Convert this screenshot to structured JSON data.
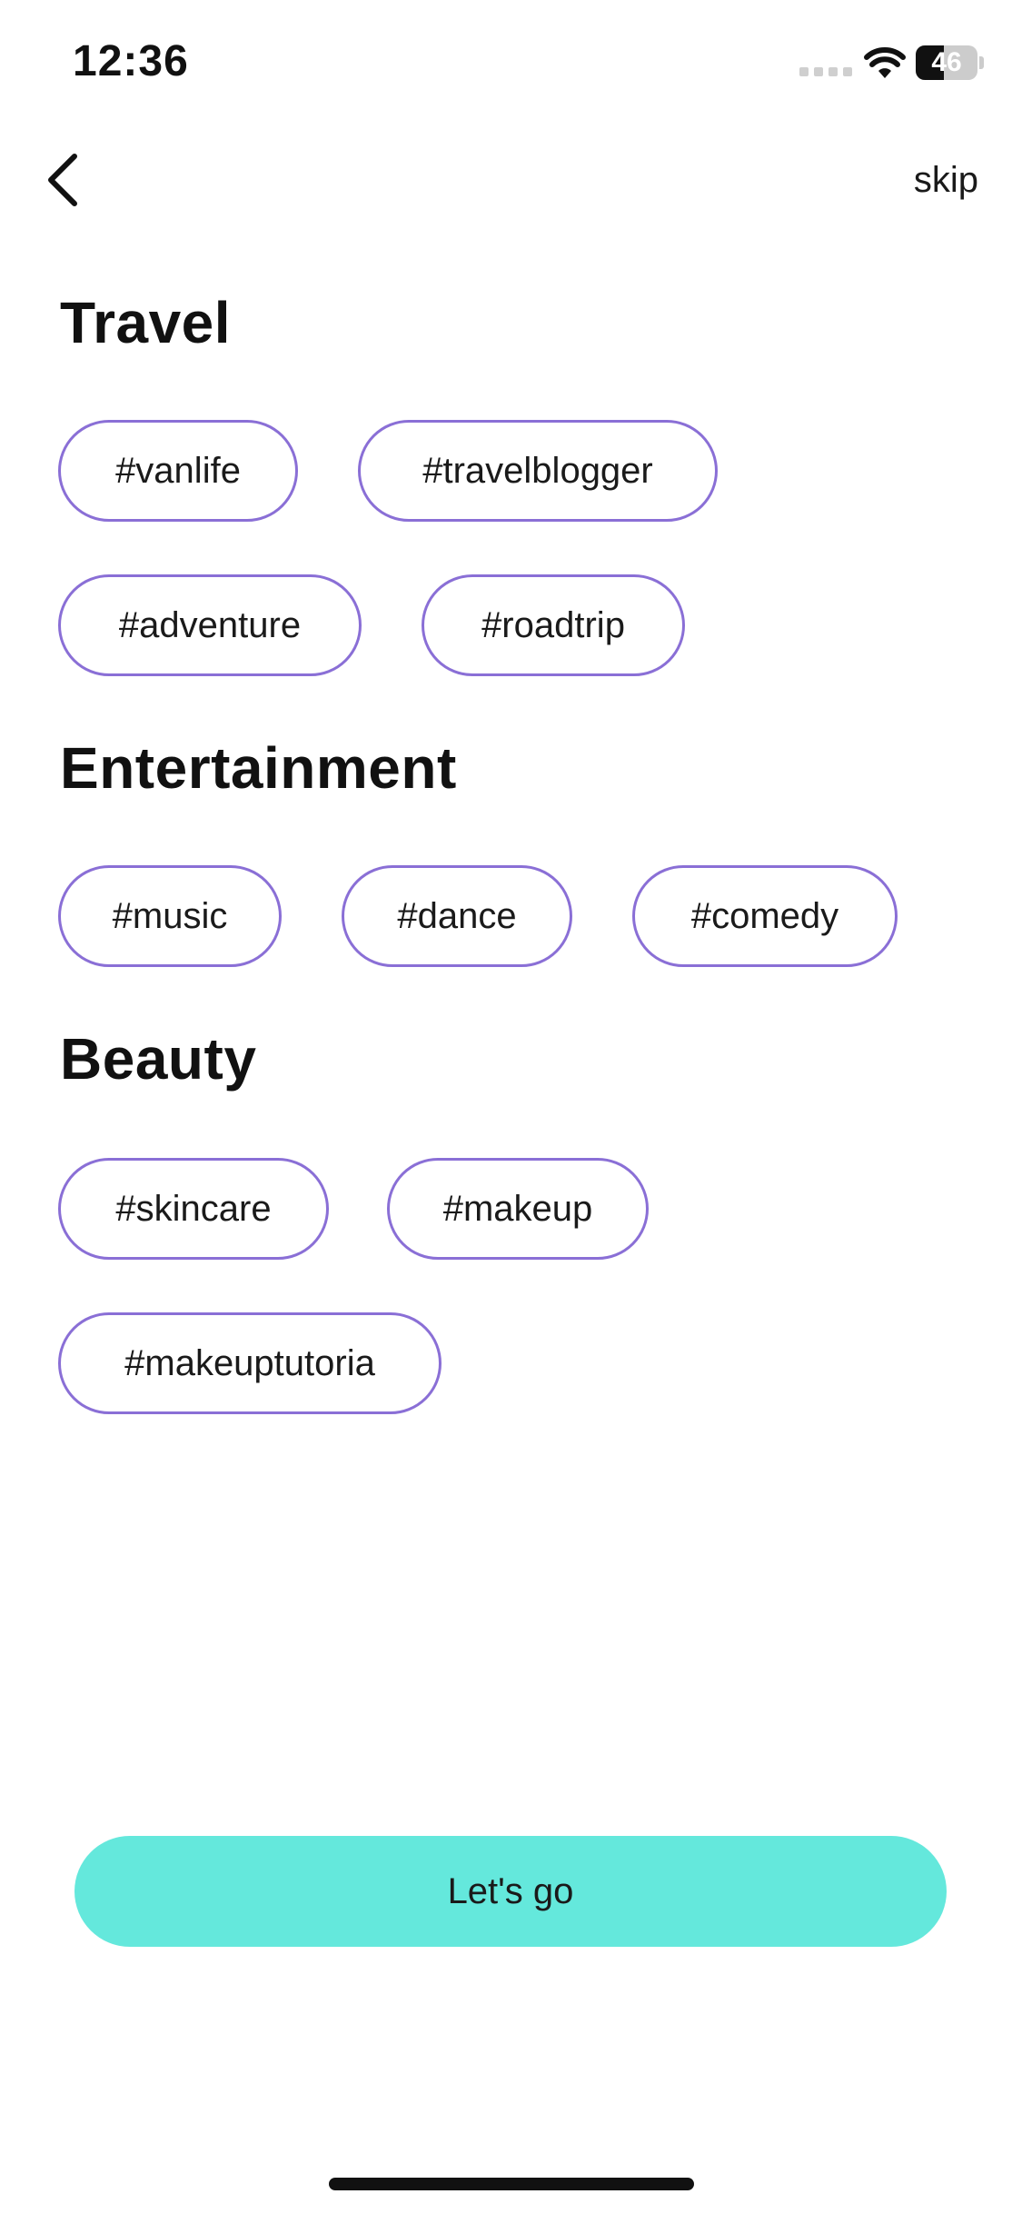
{
  "status_bar": {
    "time": "12:36",
    "battery_level": "46",
    "battery_fraction": 0.46
  },
  "nav": {
    "back_icon": "chevron-left-icon",
    "skip_label": "skip"
  },
  "sections": [
    {
      "title": "Travel",
      "tags": [
        "#vanlife",
        "#travelblogger",
        "#adventure",
        "#roadtrip"
      ]
    },
    {
      "title": "Entertainment",
      "tags": [
        "#music",
        "#dance",
        "#comedy"
      ]
    },
    {
      "title": "Beauty",
      "tags": [
        "#skincare",
        "#makeup",
        "#makeuptutoria"
      ]
    }
  ],
  "cta": {
    "label": "Let's go"
  },
  "colors": {
    "accent_border": "#8a6fd6",
    "cta_background": "#64e8dc",
    "text": "#111111"
  }
}
